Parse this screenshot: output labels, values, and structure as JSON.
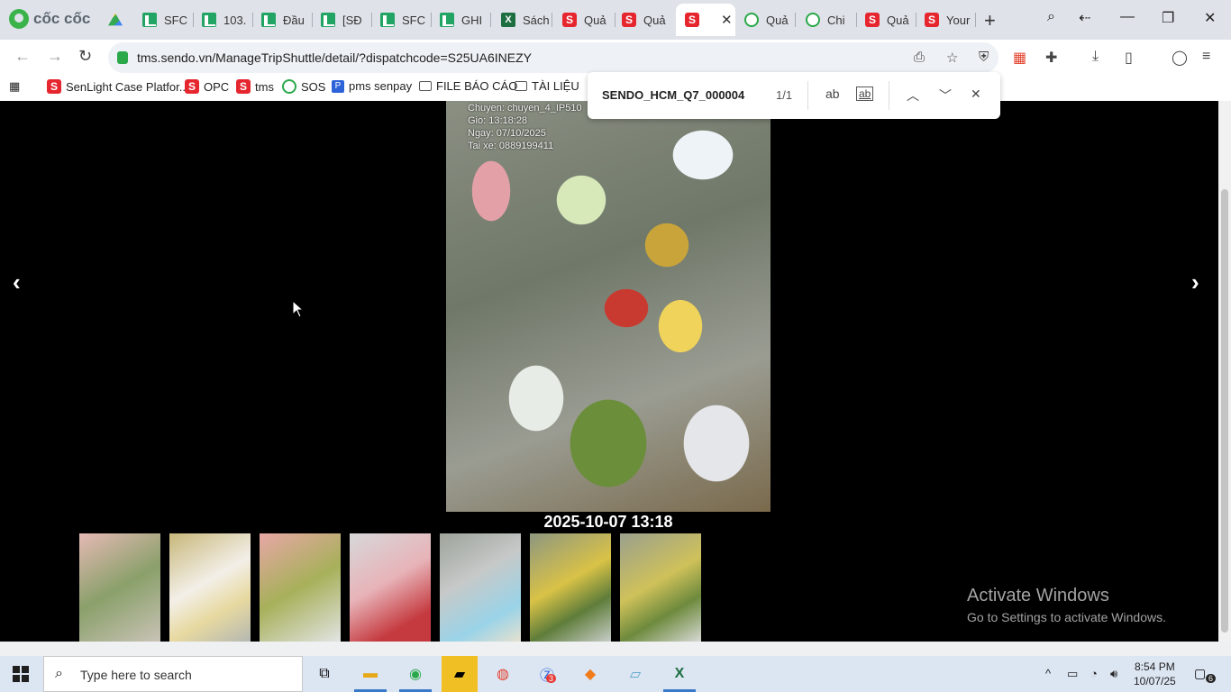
{
  "browser": {
    "brand": "cốc cốc",
    "tabs": [
      {
        "label": "SFC",
        "icon": "google-sheets-icon"
      },
      {
        "label": "103.",
        "icon": "google-sheets-icon"
      },
      {
        "label": "Đầu",
        "icon": "google-sheets-icon"
      },
      {
        "label": "[SĐ",
        "icon": "google-sheets-icon"
      },
      {
        "label": "SFC",
        "icon": "google-sheets-icon"
      },
      {
        "label": "GHI",
        "icon": "google-sheets-icon"
      },
      {
        "label": "Sách",
        "icon": "excel-icon"
      },
      {
        "label": "Quả",
        "icon": "sendo-icon"
      },
      {
        "label": "Quả",
        "icon": "sendo-icon"
      },
      {
        "label": "",
        "icon": "sendo-icon",
        "active": true
      },
      {
        "label": "Quả",
        "icon": "sos-icon"
      },
      {
        "label": "Chi",
        "icon": "sos-icon"
      },
      {
        "label": "Quả",
        "icon": "sendo-icon"
      },
      {
        "label": "Your",
        "icon": "sendo-icon"
      }
    ],
    "url": "tms.sendo.vn/ManageTripShuttle/detail/?dispatchcode=S25UA6INEZY",
    "bookmarks": [
      {
        "label": "SenLight Case Platfor...",
        "icon": "sendo-icon"
      },
      {
        "label": "OPC",
        "icon": "sendo-icon"
      },
      {
        "label": "tms",
        "icon": "sendo-icon"
      },
      {
        "label": "SOS",
        "icon": "sos-icon"
      },
      {
        "label": "pms senpay",
        "icon": "pms-icon"
      },
      {
        "label": "FILE BÁO CÁO",
        "icon": "folder-icon"
      },
      {
        "label": "TÀI LIỆU",
        "icon": "folder-icon"
      }
    ]
  },
  "find_bar": {
    "query": "SENDO_HCM_Q7_000004",
    "count": "1/1",
    "match_case_label": "ab",
    "whole_word_label": "ab"
  },
  "viewer": {
    "overlay_lines": [
      "Chuyen: chuyen_4_IP510",
      "Gio: 13:18:28",
      "Ngay: 07/10/2025",
      "Tai xe: 0889199411"
    ],
    "caption": "2025-10-07 13:18",
    "prev_label": "‹",
    "next_label": "›",
    "thumbnail_count": 7
  },
  "watermark": {
    "title": "Activate Windows",
    "subtitle": "Go to Settings to activate Windows."
  },
  "taskbar": {
    "search_placeholder": "Type here to search",
    "time": "8:54 PM",
    "date": "10/07/25",
    "notification_count": "6",
    "zalo_badge": "3"
  }
}
